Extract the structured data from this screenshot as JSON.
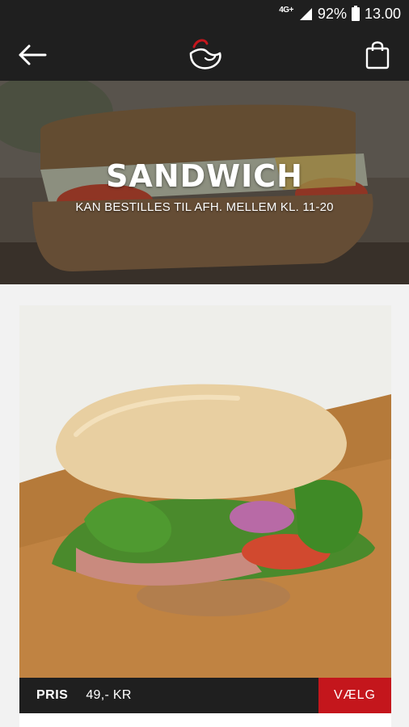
{
  "status_bar": {
    "network": "4G+",
    "battery": "92%",
    "time": "13.00"
  },
  "app_bar": {
    "back_icon": "arrow-left-icon",
    "logo_icon": "bird-logo-icon",
    "cart_icon": "shopping-bag-icon"
  },
  "hero": {
    "title": "SANDWICH",
    "subtitle": "KAN BESTILLES TIL AFH. MELLEM KL. 11-20"
  },
  "product": {
    "price_label": "PRIS",
    "price_value": "49,- KR",
    "select_label": "VÆLG"
  },
  "colors": {
    "bar": "#1f1f1f",
    "accent": "#c4161c",
    "background": "#f2f2f2"
  }
}
